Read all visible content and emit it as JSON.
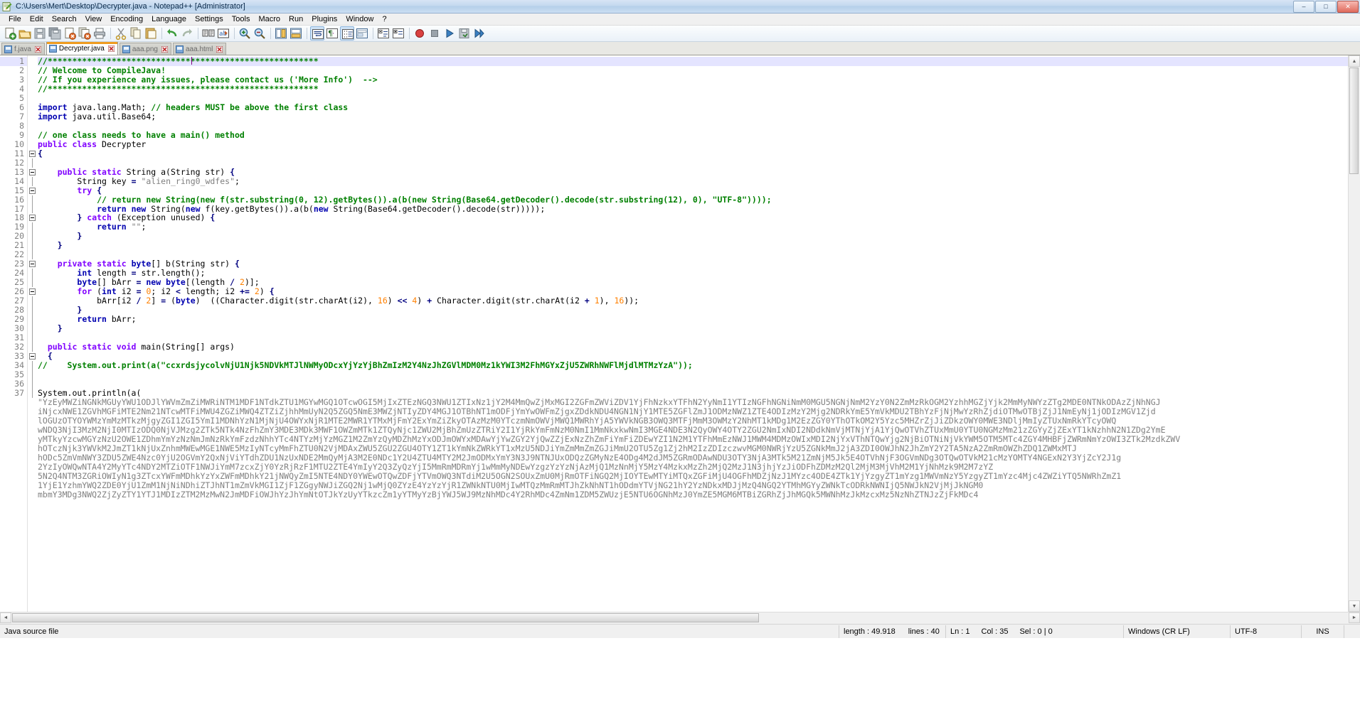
{
  "window": {
    "title": "C:\\Users\\Mert\\Desktop\\Decrypter.java - Notepad++ [Administrator]",
    "minimize_label": "–",
    "maximize_label": "□",
    "close_label": "✕"
  },
  "menubar": {
    "items": [
      {
        "label": "File"
      },
      {
        "label": "Edit"
      },
      {
        "label": "Search"
      },
      {
        "label": "View"
      },
      {
        "label": "Encoding"
      },
      {
        "label": "Language"
      },
      {
        "label": "Settings"
      },
      {
        "label": "Tools"
      },
      {
        "label": "Macro"
      },
      {
        "label": "Run"
      },
      {
        "label": "Plugins"
      },
      {
        "label": "Window"
      },
      {
        "label": "?"
      }
    ]
  },
  "toolbar": {
    "buttons": [
      {
        "name": "new-file-icon",
        "tooltip": "New"
      },
      {
        "name": "open-file-icon",
        "tooltip": "Open"
      },
      {
        "name": "save-icon",
        "tooltip": "Save"
      },
      {
        "name": "save-all-icon",
        "tooltip": "Save All"
      },
      {
        "name": "close-file-icon",
        "tooltip": "Close"
      },
      {
        "name": "close-all-icon",
        "tooltip": "Close All"
      },
      {
        "name": "print-icon",
        "tooltip": "Print"
      },
      {
        "name": "cut-icon",
        "tooltip": "Cut"
      },
      {
        "name": "copy-icon",
        "tooltip": "Copy"
      },
      {
        "name": "paste-icon",
        "tooltip": "Paste"
      },
      {
        "name": "undo-icon",
        "tooltip": "Undo"
      },
      {
        "name": "redo-icon",
        "tooltip": "Redo"
      },
      {
        "name": "find-icon",
        "tooltip": "Find"
      },
      {
        "name": "replace-icon",
        "tooltip": "Replace"
      },
      {
        "name": "zoom-in-icon",
        "tooltip": "Zoom In"
      },
      {
        "name": "zoom-out-icon",
        "tooltip": "Zoom Out"
      },
      {
        "name": "sync-vertical-icon",
        "tooltip": "Synchronize Vertical Scrolling"
      },
      {
        "name": "sync-horizontal-icon",
        "tooltip": "Synchronize Horizontal Scrolling"
      },
      {
        "name": "word-wrap-icon",
        "tooltip": "Word wrap"
      },
      {
        "name": "show-all-chars-icon",
        "tooltip": "Show All Characters"
      },
      {
        "name": "indent-guide-icon",
        "tooltip": "Show Indent Guide"
      },
      {
        "name": "user-dlg-icon",
        "tooltip": "User Defined Dialogue"
      },
      {
        "name": "fold-all-icon",
        "tooltip": "Fold All"
      },
      {
        "name": "unfold-all-icon",
        "tooltip": "Unfold All"
      },
      {
        "name": "macro-record-icon",
        "tooltip": "Start Recording"
      },
      {
        "name": "macro-stop-icon",
        "tooltip": "Stop Recording"
      },
      {
        "name": "macro-play-icon",
        "tooltip": "Playback"
      },
      {
        "name": "macro-save-icon",
        "tooltip": "Save Current Recorded Macro"
      },
      {
        "name": "macro-run-multiple-icon",
        "tooltip": "Run a Macro Multiple Times"
      }
    ]
  },
  "tabs": [
    {
      "label": "f.java",
      "active": false
    },
    {
      "label": "Decrypter.java",
      "active": true
    },
    {
      "label": "aaa.png",
      "active": false
    },
    {
      "label": "aaa.html",
      "active": false
    }
  ],
  "editor": {
    "total_lines": 40,
    "caret_line": 1,
    "caret_col": 35,
    "lines": [
      {
        "n": 1,
        "html": "<span class=\"cm\">//*******************************************************</span>",
        "current": true
      },
      {
        "n": 2,
        "html": "<span class=\"cm\">// Welcome to CompileJava!</span>"
      },
      {
        "n": 3,
        "html": "<span class=\"cm\">// If you experience any issues, please contact us ('More Info')  --&gt;</span>"
      },
      {
        "n": 4,
        "html": "<span class=\"cm\">//*******************************************************</span>"
      },
      {
        "n": 5,
        "html": ""
      },
      {
        "n": 6,
        "html": "<span class=\"kb\">import</span> <span class=\"pl\">java.lang.Math;</span> <span class=\"cm\">// headers MUST be above the first class</span>"
      },
      {
        "n": 7,
        "html": "<span class=\"kb\">import</span> <span class=\"pl\">java.util.Base64;</span>"
      },
      {
        "n": 8,
        "html": ""
      },
      {
        "n": 9,
        "html": "<span class=\"cm\">// one class needs to have a main() method</span>"
      },
      {
        "n": 10,
        "html": "<span class=\"k\">public class</span> <span class=\"pl\">Decrypter</span>"
      },
      {
        "n": 11,
        "html": "<span class=\"op\">{</span>"
      },
      {
        "n": 12,
        "html": ""
      },
      {
        "n": 13,
        "html": "    <span class=\"k\">public static</span> <span class=\"pl\">String a(String str)</span> <span class=\"op\">{</span>"
      },
      {
        "n": 14,
        "html": "        <span class=\"pl\">String key</span> <span class=\"op\">=</span> <span class=\"st\">\"alien_ring0_wdfes\"</span><span class=\"pl\">;</span>"
      },
      {
        "n": 15,
        "html": "        <span class=\"k\">try</span> <span class=\"op\">{</span>"
      },
      {
        "n": 16,
        "html": "            <span class=\"cm\">// return new String(new f(str.substring(0, 12).getBytes()).a(b(new String(Base64.getDecoder().decode(str.substring(12), 0), \"UTF-8\"))));</span>"
      },
      {
        "n": 17,
        "html": "            <span class=\"kb\">return</span> <span class=\"kb\">new</span> <span class=\"pl\">String(</span><span class=\"kb\">new</span> <span class=\"pl\">f(key.getBytes()).a(b(</span><span class=\"kb\">new</span> <span class=\"pl\">String(Base64.getDecoder().decode(str)))));</span>"
      },
      {
        "n": 18,
        "html": "        <span class=\"op\">}</span> <span class=\"k\">catch</span> <span class=\"pl\">(Exception unused)</span> <span class=\"op\">{</span>"
      },
      {
        "n": 19,
        "html": "            <span class=\"kb\">return</span> <span class=\"st\">\"\"</span><span class=\"pl\">;</span>"
      },
      {
        "n": 20,
        "html": "        <span class=\"op\">}</span>"
      },
      {
        "n": 21,
        "html": "    <span class=\"op\">}</span>"
      },
      {
        "n": 22,
        "html": ""
      },
      {
        "n": 23,
        "html": "    <span class=\"k\">private static</span> <span class=\"kb\">byte</span><span class=\"pl\">[] b(String str)</span> <span class=\"op\">{</span>"
      },
      {
        "n": 24,
        "html": "        <span class=\"kb\">int</span> <span class=\"pl\">length</span> <span class=\"op\">=</span> <span class=\"pl\">str.length();</span>"
      },
      {
        "n": 25,
        "html": "        <span class=\"kb\">byte</span><span class=\"pl\">[] bArr</span> <span class=\"op\">=</span> <span class=\"kb\">new</span> <span class=\"kb\">byte</span><span class=\"pl\">[(length</span> <span class=\"op\">/</span> <span class=\"nm\">2</span><span class=\"pl\">)];</span>"
      },
      {
        "n": 26,
        "html": "        <span class=\"k\">for</span> <span class=\"pl\">(</span><span class=\"kb\">int</span> <span class=\"pl\">i2</span> <span class=\"op\">=</span> <span class=\"nm\">0</span><span class=\"pl\">; i2</span> <span class=\"op\">&lt;</span> <span class=\"pl\">length; i2</span> <span class=\"op\">+=</span> <span class=\"nm\">2</span><span class=\"pl\">)</span> <span class=\"op\">{</span>"
      },
      {
        "n": 27,
        "html": "            <span class=\"pl\">bArr[i2</span> <span class=\"op\">/</span> <span class=\"nm\">2</span><span class=\"pl\">]</span> <span class=\"op\">=</span> <span class=\"pl\">(</span><span class=\"kb\">byte</span><span class=\"pl\">)  ((Character.digit(str.charAt(i2),</span> <span class=\"nm\">16</span><span class=\"pl\">)</span> <span class=\"op\">&lt;&lt;</span> <span class=\"nm\">4</span><span class=\"pl\">)</span> <span class=\"op\">+</span> <span class=\"pl\">Character.digit(str.charAt(i2</span> <span class=\"op\">+</span> <span class=\"nm\">1</span><span class=\"pl\">),</span> <span class=\"nm\">16</span><span class=\"pl\">));</span>"
      },
      {
        "n": 28,
        "html": "        <span class=\"op\">}</span>"
      },
      {
        "n": 29,
        "html": "        <span class=\"kb\">return</span> <span class=\"pl\">bArr;</span>"
      },
      {
        "n": 30,
        "html": "    <span class=\"op\">}</span>"
      },
      {
        "n": 31,
        "html": ""
      },
      {
        "n": 32,
        "html": "  <span class=\"k\">public static void</span> <span class=\"pl\">main(String[] args)</span>"
      },
      {
        "n": 33,
        "html": "  <span class=\"op\">{</span>"
      },
      {
        "n": 34,
        "html": "<span class=\"cm\">//    System.out.print(a(\"ccxrdsjycolvNjU1Njk5NDVkMTJlNWMyODcxYjYzYjBhZmIzM2Y4NzJhZGVlMDM0Mz1kYWI3M2FhMGYxZjU5ZWRhNWFlMjdlMTMzYzA\"));</span>"
      },
      {
        "n": 35,
        "html": ""
      },
      {
        "n": 36,
        "html": ""
      },
      {
        "n": 37,
        "html": "<span class=\"pl\">System.out.println(a(</span>"
      }
    ],
    "blob_lines": [
      "\"YzEyMWZiNGNkMGUyYWU1ODJlYWVmZmZiMWRiNTM1MDF1NTdkZTU1MGYwMGQ1OTcwOGI5MjIxZTEzNGQ3NWU1ZTIxNz1jY2M4MmQwZjMxMGI2ZGFmZWViZDV1YjFhNzkxYTFhN2YyNmI1YTIzNGFhNGNiNmM0MGU5NGNjNmM2YzY0N2ZmMzRkOGM2YzhhMGZjYjk2MmMyNWYzZTg2MDE0NTNkODAzZjNhNGJ",
      "iNjcxNWE1ZGVhMGFiMTE2Nm21NTcwMTFiMWU4ZGZiMWQ4ZTZiZjhhMmUyN2Q5ZGQ5NmE3MWZjNTIyZDY4MGJ1OTBhNT1mODFjYmYwOWFmZjgxZDdkNDU4NGN1NjY1MTE5ZGFlZmJ1ODMzNWZ1ZTE4ODIzMzY2Mjg2NDRkYmE5YmVkMDU2TBhYzFjNjMwYzRhZjdiOTMwOTBjZjJ1NmEyNj1jODIzMGV1Zjd",
      "lOGUzOTYOYWMzYmMzMTkzMjgyZGI1ZGI5YmI1MDNhYzN1MjNjU4OWYxNjR1MTE2MWR1YTMxMjFmY2ExYmZiZkyOTAzMzM0YTczmNmOWVjMWQ1MWRhYjA5YWVkNGB3OWQ3MTFjMmM3OWMzY2NhMT1kMDg1M2EzZGY0YThOTkOM2Y5Yzc5MHZrZjJiZDkzOWY0MWE3NDljMmIyZTUxNmRkYTcyOWQ",
      "wNDQ3NjI3MzM2NjI0MTIzODQ0NjVJMzg2ZTk5NTk4NzFhZmY3MDE3MDk3MWF1OWZmMTk1ZTQyNjc1ZWU2MjBhZmUzZTRiY2I1YjRkYmFmNzM0NmI1MmNkxkwNmI3MGE4NDE3N2QyOWY4OTY2ZGU2NmIxNDI2NDdkNmVjMTNjYjA1YjQwOTVhZTUxMmU0YTU0NGMzMm21zZGYyZjZExYT1kNzhhN2N1ZDg2YmE",
      "yMTkyYzcwMGYzNzU2OWE1ZDhmYmYzNzNmJmNzRkYmFzdzNhhYTc4NTYzMjYzMGZ1M2ZmYzQyMDZhMzYxODJmOWYxMDAwYjYwZGY2YjQwZZjExNzZhZmFiYmFiZDEwYZI1N2M1YTFhMmEzNWJ1MWM4MDMzOWIxMDI2NjYxVThNTQwYjg2NjBiOTNiNjVkYWM5OTM5MTc4ZGY4MHBFjZWRmNmYzOWI3ZTk2MzdkZWV",
      "hOTczNjk3YWVkM2JmZT1kNjUxZnhmMWEwMGE1NWE5MzIyNTcyMmFhZTU0N2VjMDAxZWU5ZGU2ZGU4OTY1ZT1kYmNkZWRkYT1xMzU5NDJiYmZmMmZmZGJiMmU2OTU5Zg1Zj2hM2IzZDIzczwvMGM0NWRjYzU5ZGNkMmJ2jA3ZDI0OWJhN2JhZmY2Y2TA5NzA2ZmRmOWZhZDQ1ZWMxMTJ",
      "hODc5ZmVmNWY3ZDU5ZWE4Nzc0YjU2OGVmY2QxNjViYTdhZDU1NzUxNDE2MmQyMjA3M2E0NDc1Y2U4ZTU4MTY2M2JmODMxYmY3N3J9NTNJUxODQzZGMyNzE4ODg4M2dJM5ZGRmODAwNDU3OTY3NjA3MTk5M21ZmNjM5Jk5E4OTVhNjF3OGVmNDg3OTQwOTVkM21cMzYOMTY4NGExN2Y3YjZcY2J1g",
      "2YzIyOWQwNTA4Y2MyYTc4NDY2MTZiOTF1NWJiYmM7zcxZjY0YzRjRzF1MTU2ZTE4YmIyY2Q3ZyQzYjI5MmRmMDRmYj1wMmMyNDEwYzgzYzYzNjAzMjQ1MzNnMjY5MzY4MzkxMzZh2MjQ2MzJ1N3jhjYzJiODFhZDMzM2Ql2MjM3MjVhM2M1YjNhMzk9M2M7zYZ",
      "5N2Q4NTM3ZGRiOWIyN1g3ZTcxYWFmMDhkYzYxZWFmMDhkY21jNWQyZmI5NTE4NDY0YWEwOTQwZDFjYTVmOWQ3NTdiM2U5OGN2SOUxZmU0MjRmOTFiNGQ2MjIOYTEwMTYiMTQxZGFiMjU4OGFhMDZjNzJ1MYzc4ODE4ZTk1YjYzgyZT1mYzg1MWVmNzY5YzgyZT1mYzc4Mjc4ZWZiYTQ5NWRhZmZ1",
      "1YjE1YzhmYWQ2ZDE0YjU1ZmM1NjNiNDhiZTJhNT1mZmVkMGI1ZjF1ZGgyNWJiZGQ2Nj1wMjQ0ZYzE4YzYzYjR1ZWNkNTU0MjIwMTQzMmRmMTJhZkNhNT1hODdmYTVjNG21hY2YzNDkxMDJjMzQ4NGQ2YTMhMGYyZWNkTcODRkNWNIjQ5NWJkN2VjMjJkNGM0",
      "mbmY3MDg3NWQ2ZjZyZTY1YTJ1MDIzZTM2MzMwN2JmMDFiOWJhYzJhYmNtOTJkYzUyYTkzcZm1yYTMyYzBjYWJ5WJ9MzNhMDc4Y2RhMDc4ZmNm1ZDM5ZWUzjE5NTU6OGNhMzJ0YmZE5MGM6MTBiZGRhZjJhMGQk5MWNhMzJkMzcxMz5NzNhZTNJzZjFkMDc4"
    ]
  },
  "scrollbars": {
    "up_arrow": "▲",
    "down_arrow": "▼",
    "left_arrow": "◄",
    "right_arrow": "►"
  },
  "statusbar": {
    "doc_type": "Java source file",
    "length_label": "length : 49.918",
    "lines_label": "lines : 40",
    "ln_label": "Ln : 1",
    "col_label": "Col : 35",
    "sel_label": "Sel : 0 | 0",
    "eol": "Windows (CR LF)",
    "encoding": "UTF-8",
    "insert_mode": "INS"
  },
  "colors": {
    "accent_tab": "#ef9c20",
    "comment": "#008000",
    "keyword": "#8000ff",
    "type_keyword": "#0000b0",
    "string": "#808080",
    "number": "#ff8000",
    "caret_line": "#e4e4ff",
    "titlebar": "#c3d8ef"
  }
}
